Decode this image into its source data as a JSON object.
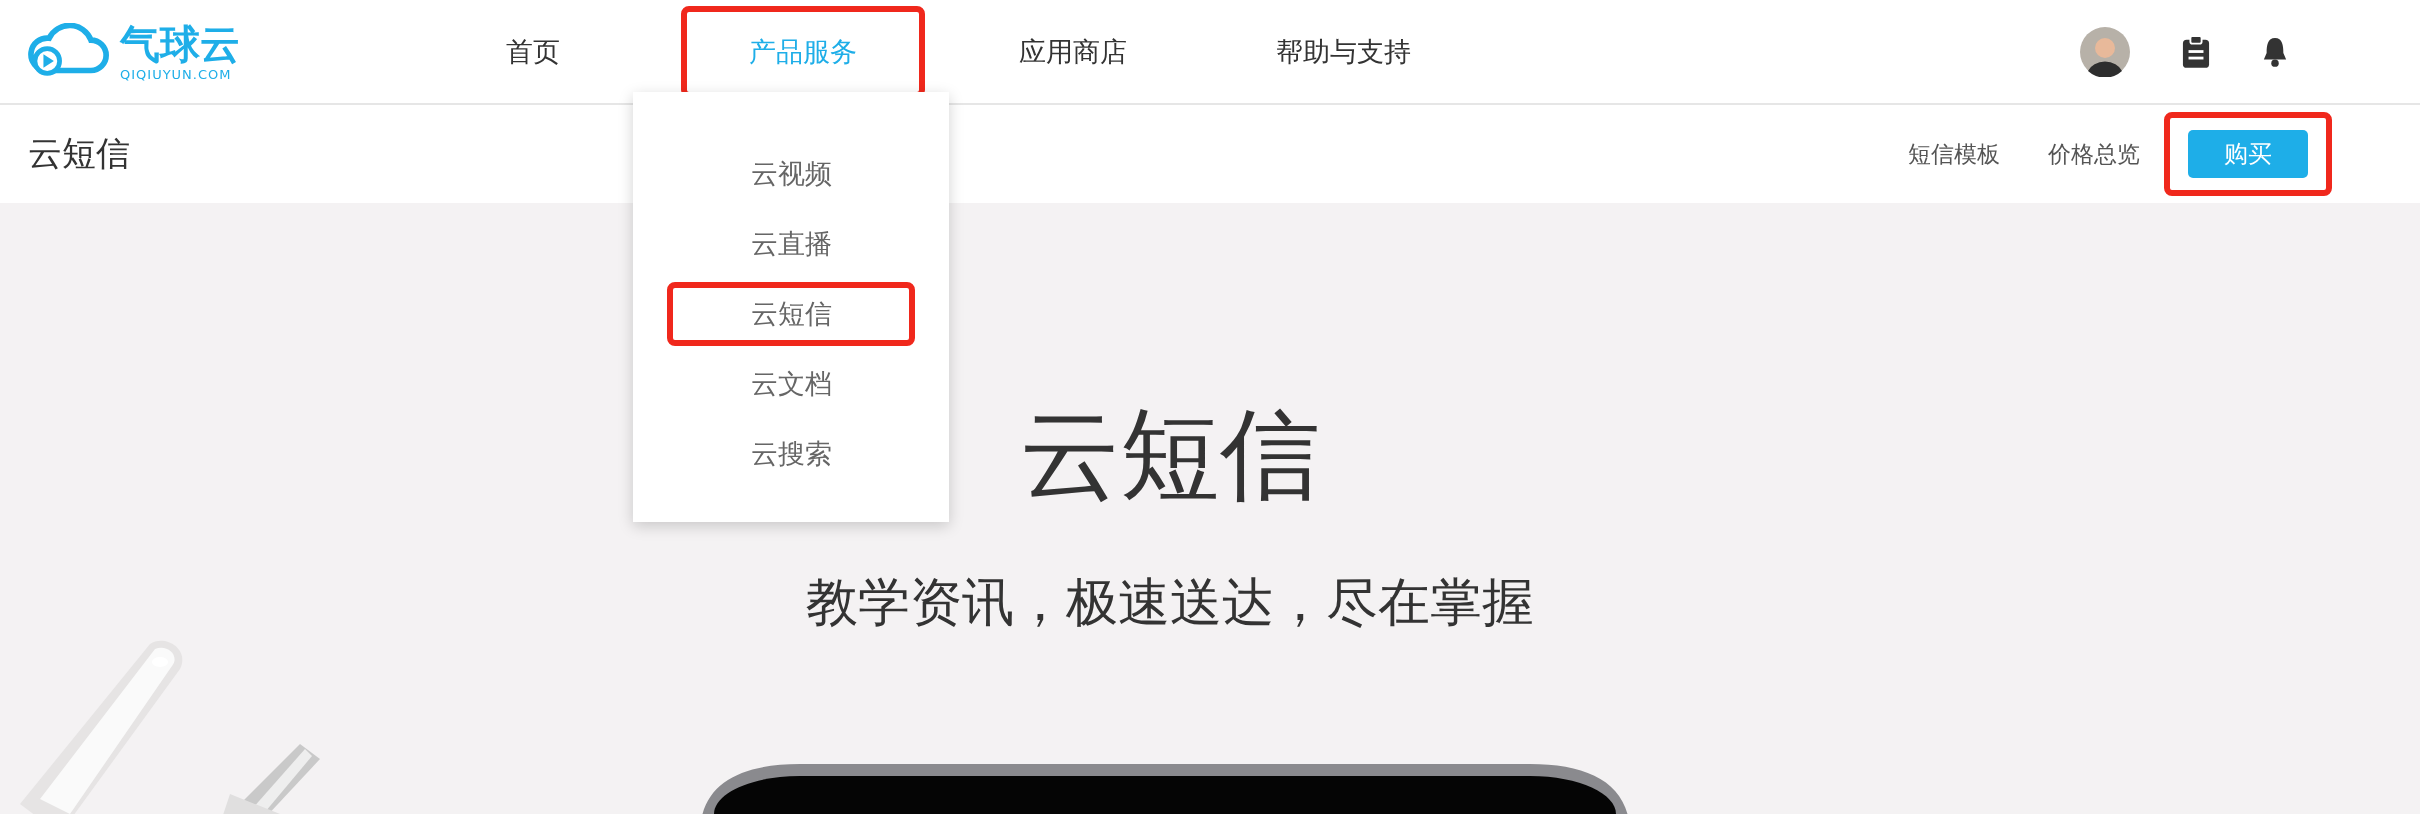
{
  "logo": {
    "name": "气球云",
    "domain": "QIQIUYUN.COM"
  },
  "nav": [
    {
      "label": "首页",
      "selected": false,
      "highlighted": false
    },
    {
      "label": "产品服务",
      "selected": true,
      "highlighted": true,
      "menu": [
        {
          "label": "云视频",
          "highlighted": false
        },
        {
          "label": "云直播",
          "highlighted": false
        },
        {
          "label": "云短信",
          "highlighted": true
        },
        {
          "label": "云文档",
          "highlighted": false
        },
        {
          "label": "云搜索",
          "highlighted": false
        }
      ]
    },
    {
      "label": "应用商店",
      "selected": false,
      "highlighted": false
    },
    {
      "label": "帮助与支持",
      "selected": false,
      "highlighted": false
    }
  ],
  "subbar": {
    "title": "云短信",
    "links": [
      "短信模板",
      "价格总览"
    ],
    "button": {
      "label": "购买",
      "highlighted": true
    }
  },
  "hero": {
    "title": "云短信",
    "subtitle": "教学资讯，极速送达，尽在掌握"
  }
}
